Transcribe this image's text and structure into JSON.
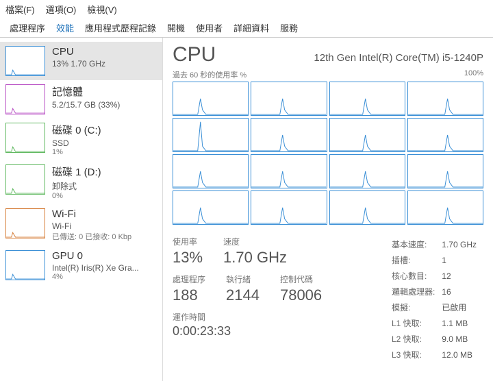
{
  "menubar": [
    "檔案(F)",
    "選項(O)",
    "檢視(V)"
  ],
  "tabs": [
    "處理程序",
    "效能",
    "應用程式歷程記錄",
    "開機",
    "使用者",
    "詳細資料",
    "服務"
  ],
  "activeTab": 1,
  "sidebar": [
    {
      "title": "CPU",
      "sub": "13% 1.70 GHz",
      "color": "#3a8fd6",
      "selected": true
    },
    {
      "title": "記憶體",
      "sub": "5.2/15.7 GB (33%)",
      "color": "#b84fc4"
    },
    {
      "title": "磁碟 0 (C:)",
      "sub": "SSD",
      "sub2": "1%",
      "color": "#5fb85f"
    },
    {
      "title": "磁碟 1 (D:)",
      "sub": "卸除式",
      "sub2": "0%",
      "color": "#5fb85f"
    },
    {
      "title": "Wi-Fi",
      "sub": "Wi-Fi",
      "sub2": "已傳送: 0 已接收: 0 Kbp",
      "color": "#d67f3a"
    },
    {
      "title": "GPU 0",
      "sub": "Intel(R) Iris(R) Xe Gra...",
      "sub2": "4%",
      "color": "#3a8fd6"
    }
  ],
  "header": {
    "title": "CPU",
    "model": "12th Gen Intel(R) Core(TM) i5-1240P"
  },
  "graphLabel": {
    "left": "過去 60 秒的使用率 %",
    "right": "100%"
  },
  "stats": {
    "usage": {
      "lbl": "使用率",
      "val": "13%"
    },
    "speed": {
      "lbl": "速度",
      "val": "1.70 GHz"
    },
    "processes": {
      "lbl": "處理程序",
      "val": "188"
    },
    "threads": {
      "lbl": "執行緒",
      "val": "2144"
    },
    "handles": {
      "lbl": "控制代碼",
      "val": "78006"
    },
    "uptime": {
      "lbl": "運作時間",
      "val": "0:00:23:33"
    }
  },
  "details": [
    [
      "基本速度:",
      "1.70 GHz"
    ],
    [
      "插槽:",
      "1"
    ],
    [
      "核心數目:",
      "12"
    ],
    [
      "邏輯處理器:",
      "16"
    ],
    [
      "模擬:",
      "已啟用"
    ],
    [
      "L1 快取:",
      "1.1 MB"
    ],
    [
      "L2 快取:",
      "9.0 MB"
    ],
    [
      "L3 快取:",
      "12.0 MB"
    ]
  ],
  "chart_data": {
    "type": "line",
    "title": "CPU 使用率 (16 邏輯處理器)",
    "xlabel": "過去 60 秒",
    "ylabel": "%",
    "ylim": [
      0,
      100
    ],
    "series_count": 16,
    "note": "Each of 16 logical-processor panes shows a small spike (~30-60%) roughly mid-window, otherwise near 0%. Pane 5 (row 2 col 1) shows a tall spike near 90% at the start."
  }
}
